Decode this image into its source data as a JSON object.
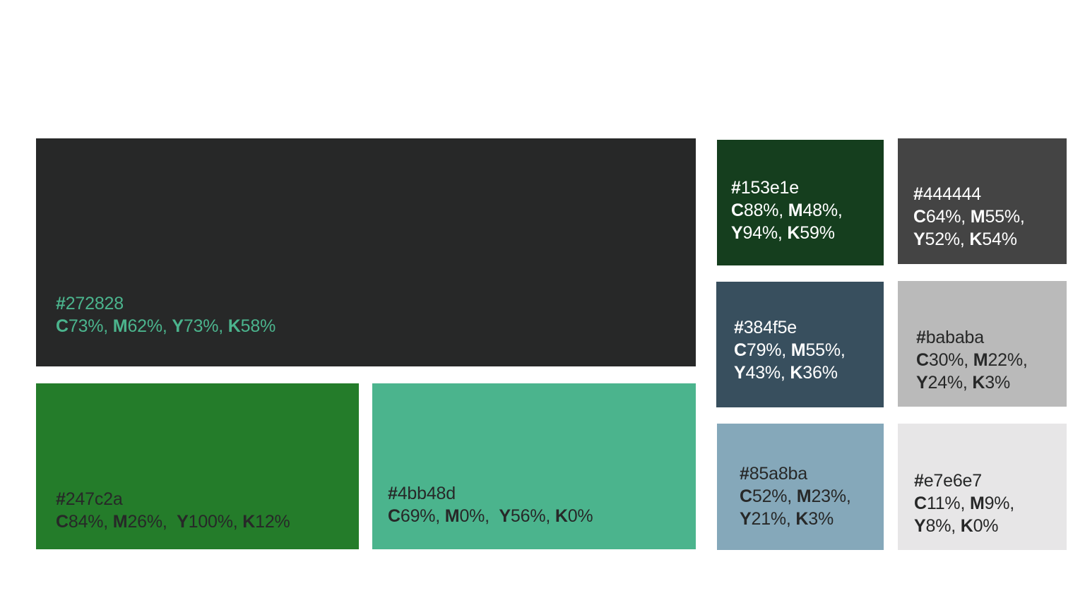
{
  "swatches": [
    {
      "id": "272828",
      "bg": "#272828",
      "text_color": "#4bb48d",
      "hex": "272828",
      "lines": [
        [
          [
            "#",
            "272828"
          ]
        ],
        [
          [
            "C",
            "73%, "
          ],
          [
            "M",
            "62%, "
          ],
          [
            "Y",
            "73%, "
          ],
          [
            "K",
            "58%"
          ]
        ]
      ]
    },
    {
      "id": "247c2a",
      "bg": "#247c2a",
      "text_color": "#272828",
      "hex": "247c2a",
      "lines": [
        [
          [
            "#",
            "247c2a"
          ]
        ],
        [
          [
            "C",
            "84%, "
          ],
          [
            "M",
            "26%,  "
          ],
          [
            "Y",
            "100%, "
          ],
          [
            "K",
            "12%"
          ]
        ]
      ]
    },
    {
      "id": "4bb48d",
      "bg": "#4bb48d",
      "text_color": "#272828",
      "hex": "4bb48d",
      "lines": [
        [
          [
            "#",
            "4bb48d"
          ]
        ],
        [
          [
            "C",
            "69%, "
          ],
          [
            "M",
            "0%,  "
          ],
          [
            "Y",
            "56%, "
          ],
          [
            "K",
            "0%"
          ]
        ]
      ]
    },
    {
      "id": "153e1e",
      "bg": "#153e1e",
      "text_color": "#ffffff",
      "hex": "153e1e",
      "lines": [
        [
          [
            "#",
            "153e1e"
          ]
        ],
        [
          [
            "C",
            "88%, "
          ],
          [
            "M",
            "48%,"
          ]
        ],
        [
          [
            "Y",
            "94%, "
          ],
          [
            "K",
            "59%"
          ]
        ]
      ]
    },
    {
      "id": "444444",
      "bg": "#444444",
      "text_color": "#ffffff",
      "hex": "444444",
      "lines": [
        [
          [
            "#",
            "444444"
          ]
        ],
        [
          [
            "C",
            "64%, "
          ],
          [
            "M",
            "55%,"
          ]
        ],
        [
          [
            "Y",
            "52%, "
          ],
          [
            "K",
            "54%"
          ]
        ]
      ]
    },
    {
      "id": "384f5e",
      "bg": "#384f5e",
      "text_color": "#ffffff",
      "hex": "384f5e",
      "lines": [
        [
          [
            "#",
            "384f5e"
          ]
        ],
        [
          [
            "C",
            "79%, "
          ],
          [
            "M",
            "55%,"
          ]
        ],
        [
          [
            "Y",
            "43%, "
          ],
          [
            "K",
            "36%"
          ]
        ]
      ]
    },
    {
      "id": "bababa",
      "bg": "#bababa",
      "text_color": "#272828",
      "hex": "bababa",
      "lines": [
        [
          [
            "#",
            "bababa"
          ]
        ],
        [
          [
            "C",
            "30%, "
          ],
          [
            "M",
            "22%,"
          ]
        ],
        [
          [
            "Y",
            "24%, "
          ],
          [
            "K",
            "3%"
          ]
        ]
      ]
    },
    {
      "id": "85a8ba",
      "bg": "#85a8ba",
      "text_color": "#272828",
      "hex": "85a8ba",
      "lines": [
        [
          [
            "#",
            "85a8ba"
          ]
        ],
        [
          [
            "C",
            "52%, "
          ],
          [
            "M",
            "23%,"
          ]
        ],
        [
          [
            "Y",
            "21%, "
          ],
          [
            "K",
            "3%"
          ]
        ]
      ]
    },
    {
      "id": "e7e6e7",
      "bg": "#e7e6e7",
      "text_color": "#272828",
      "hex": "e7e6e7",
      "lines": [
        [
          [
            "#",
            "e7e6e7"
          ]
        ],
        [
          [
            "C",
            "11%, "
          ],
          [
            "M",
            "9%,"
          ]
        ],
        [
          [
            "Y",
            "8%, "
          ],
          [
            "K",
            "0%"
          ]
        ]
      ]
    }
  ]
}
